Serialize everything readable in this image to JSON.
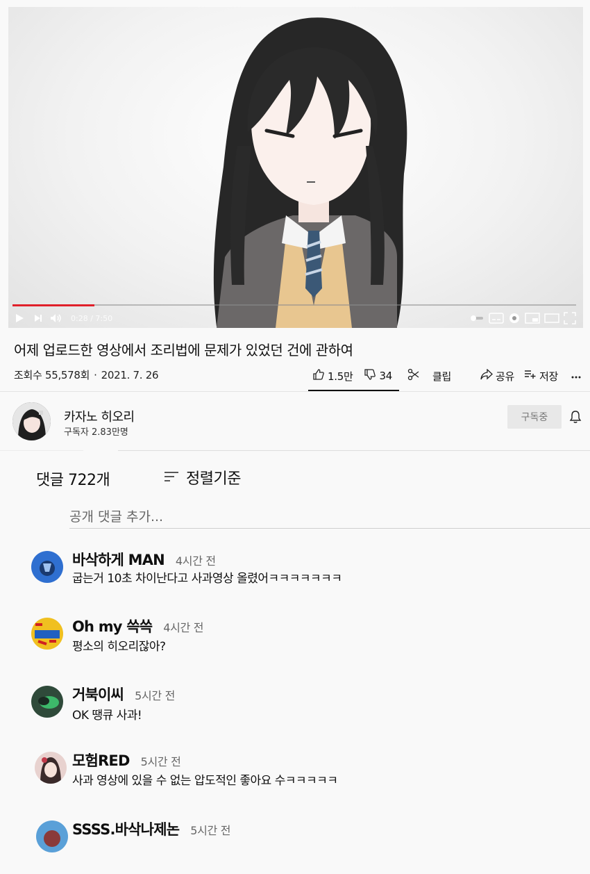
{
  "player": {
    "time_current": "0:28",
    "time_total": "7:50",
    "progress": 0.145
  },
  "video": {
    "title": "어제 업로드한 영상에서 조리법에 문제가  있었던 건에 관하여",
    "views": "조회수 55,578회",
    "date": "2021. 7. 26"
  },
  "actions": {
    "like": "1.5만",
    "dislike": "34",
    "clip": "클립",
    "share": "공유",
    "save": "저장"
  },
  "channel": {
    "name": "카자노 히오리",
    "subscribers": "구독자 2.83만명",
    "subscribe_label": "구독중"
  },
  "comments_header": {
    "count": "댓글 722개",
    "sort": "정렬기준",
    "placeholder": "공개 댓글 추가..."
  },
  "comments": [
    {
      "author": "바삭하게 MAN",
      "time": "4시간 전",
      "text": "굽는거 10초 차이난다고 사과영상 올렸어ㅋㅋㅋㅋㅋㅋㅋ",
      "avatar_color": "#2f6fd0"
    },
    {
      "author": "Oh my 쓱쓱",
      "time": "4시간 전",
      "text": "평소의 히오리잖아?",
      "avatar_color": "#f0c020"
    },
    {
      "author": "거북이씨",
      "time": "5시간 전",
      "text": "OK 땡큐 사과!",
      "avatar_color": "#2f4a3a"
    },
    {
      "author": "모험RED",
      "time": "5시간 전",
      "text": "사과 영상에 있을 수 없는 압도적인 좋아요 수ㅋㅋㅋㅋㅋ",
      "avatar_color": "#c98080"
    },
    {
      "author": "SSSS.바삭나제논",
      "time": "5시간 전",
      "text": "",
      "avatar_color": "#5aa0d8"
    }
  ],
  "colors": {
    "progress": "#e0202a",
    "background": "#f9f9f9"
  }
}
